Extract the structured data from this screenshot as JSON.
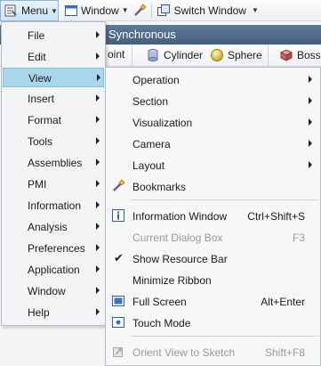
{
  "toolbar": {
    "menu_label": "Menu",
    "window_label": "Window",
    "switch_window_label": "Switch Window"
  },
  "background": {
    "title": "Synchronous",
    "ribbon": {
      "point_fragment": "oint",
      "cylinder_label": "Cylinder",
      "sphere_label": "Sphere",
      "boss_fragment": "Boss"
    }
  },
  "main_menu": {
    "items": [
      {
        "label": "File"
      },
      {
        "label": "Edit"
      },
      {
        "label": "View"
      },
      {
        "label": "Insert"
      },
      {
        "label": "Format"
      },
      {
        "label": "Tools"
      },
      {
        "label": "Assemblies"
      },
      {
        "label": "PMI"
      },
      {
        "label": "Information"
      },
      {
        "label": "Analysis"
      },
      {
        "label": "Preferences"
      },
      {
        "label": "Application"
      },
      {
        "label": "Window"
      },
      {
        "label": "Help"
      }
    ]
  },
  "view_menu": {
    "operation": "Operation",
    "section": "Section",
    "visualization": "Visualization",
    "camera": "Camera",
    "layout": "Layout",
    "bookmarks": "Bookmarks",
    "information_window": "Information Window",
    "information_window_shortcut": "Ctrl+Shift+S",
    "current_dialog_box": "Current Dialog Box",
    "current_dialog_box_shortcut": "F3",
    "show_resource_bar": "Show Resource Bar",
    "minimize_ribbon": "Minimize Ribbon",
    "full_screen": "Full Screen",
    "full_screen_shortcut": "Alt+Enter",
    "touch_mode": "Touch Mode",
    "orient_view_to_sketch": "Orient View to Sketch",
    "orient_view_to_sketch_shortcut": "Shift+F8"
  },
  "colors": {
    "highlight": "#a8d6ea",
    "title_bar": "#4e6a88",
    "disabled_text": "#9a9a9a"
  }
}
